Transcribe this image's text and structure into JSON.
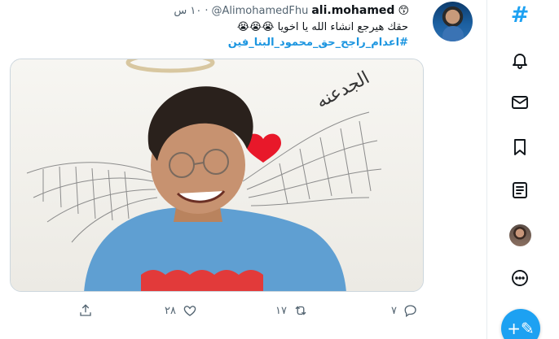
{
  "tweet": {
    "display_name": "ali.mohamed",
    "name_emoji": "😙",
    "handle": "@AlimohamedFhu",
    "dot": "·",
    "time": "١٠ س",
    "text": "حقك هيرجع انشاء الله يا اخويا 😭😭😭",
    "hashtag": "#اعدام_راجح_حق_محمود_البنا_فين",
    "media_caption": "الجدعنه"
  },
  "actions": {
    "reply_count": "٧",
    "retweet_count": "١٧",
    "like_count": "٢٨"
  },
  "icons": {
    "reply": "reply-icon",
    "retweet": "retweet-icon",
    "like": "heart-icon",
    "share": "share-icon"
  },
  "nav": {
    "explore_glyph": "#",
    "compose_glyph": "+✎"
  },
  "colors": {
    "accent": "#1da1f2",
    "hashtag": "#1b95e0",
    "muted": "#536471"
  }
}
